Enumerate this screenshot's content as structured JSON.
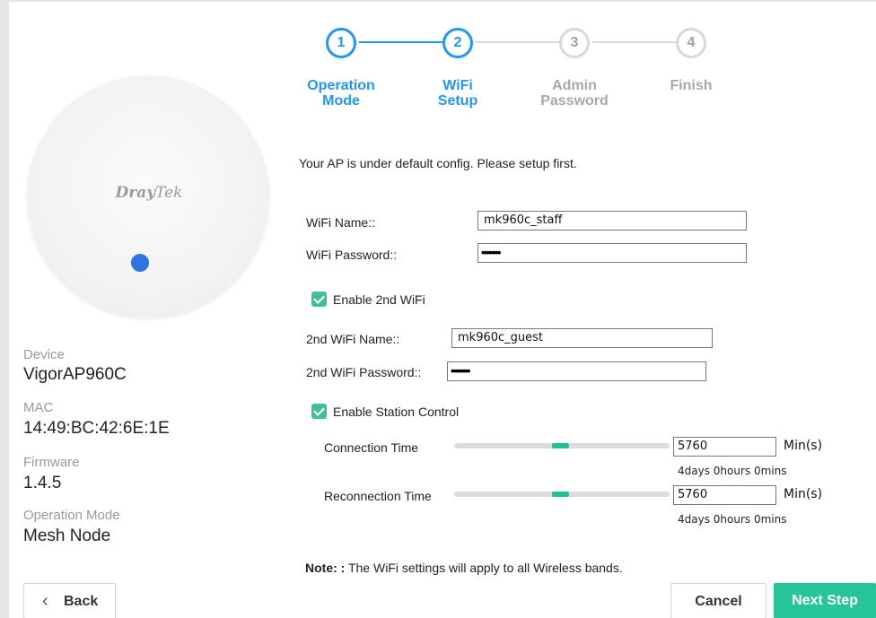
{
  "stepper": {
    "steps": [
      {
        "number": "1",
        "label_line1": "Operation",
        "label_line2": "Mode",
        "state": "active"
      },
      {
        "number": "2",
        "label_line1": "WiFi",
        "label_line2": "Setup",
        "state": "active"
      },
      {
        "number": "3",
        "label_line1": "Admin",
        "label_line2": "Password",
        "state": "inactive"
      },
      {
        "number": "4",
        "label_line1": "Finish",
        "label_line2": "",
        "state": "inactive"
      }
    ],
    "active_color": "#2196f3",
    "inactive_color": "#d8d8d8"
  },
  "device": {
    "brand_bold": "Dray",
    "brand_rest": "Tek",
    "led_color": "#2f74e0",
    "device_label": "Device",
    "device_value": "VigorAP960C",
    "mac_label": "MAC",
    "mac_value": "14:49:BC:42:6E:1E",
    "firmware_label": "Firmware",
    "firmware_value": "1.4.5",
    "mode_label": "Operation Mode",
    "mode_value": "Mesh Node"
  },
  "form": {
    "intro": "Your AP is under default config. Please setup first.",
    "wifi_name_label": "WiFi Name::",
    "wifi_name_value": "mk960c_staff",
    "wifi_password_label": "WiFi Password::",
    "wifi_password_masked": "••••••••",
    "enable_2nd_wifi_label": "Enable 2nd WiFi",
    "enable_2nd_wifi_checked": true,
    "wifi2_name_label": "2nd WiFi Name::",
    "wifi2_name_value": "mk960c_guest",
    "wifi2_password_label": "2nd WiFi Password::",
    "wifi2_password_masked": "••••••••",
    "enable_station_control_label": "Enable Station Control",
    "enable_station_control_checked": true,
    "connection_time_label": "Connection Time",
    "connection_time_value": "5760",
    "connection_time_unit": "Min(s)",
    "connection_time_duration": "4days 0hours 0mins",
    "reconnection_time_label": "Reconnection Time",
    "reconnection_time_value": "5760",
    "reconnection_time_unit": "Min(s)",
    "reconnection_time_duration": "4days 0hours 0mins",
    "note_bold": "Note: :",
    "note_text": " The WiFi settings will apply to all Wireless bands."
  },
  "buttons": {
    "back_icon": "‹",
    "back_label": "Back",
    "cancel_label": "Cancel",
    "next_label": "Next Step",
    "next_color": "#26c598"
  }
}
